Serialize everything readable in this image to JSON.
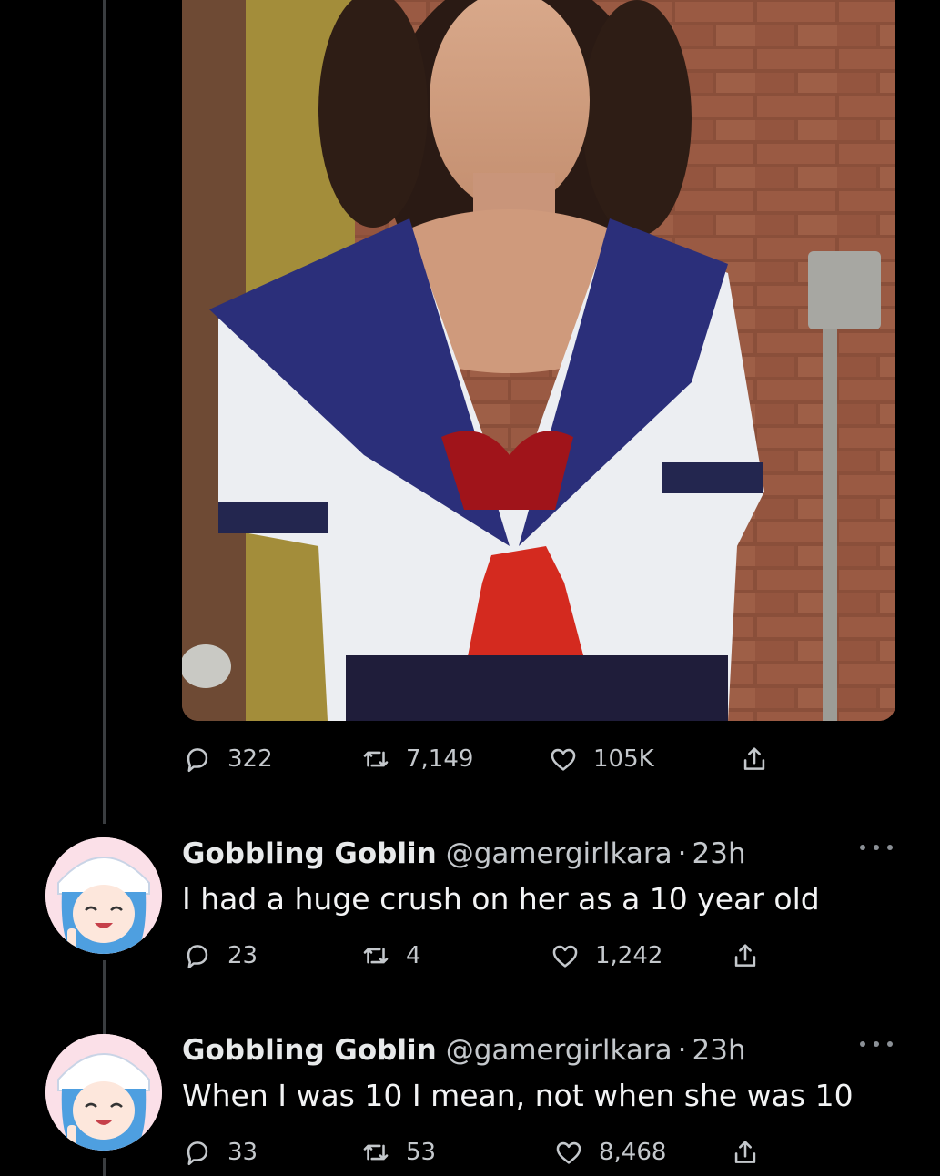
{
  "colors": {
    "background": "#000000",
    "text_primary": "#e7e9ea",
    "text_secondary": "#c4c8cc",
    "thread_line": "#3a3d40"
  },
  "main_tweet": {
    "media_description_icon": "photo",
    "actions": {
      "replies": "322",
      "retweets": "7,149",
      "likes": "105K"
    }
  },
  "replies": [
    {
      "avatar_icon": "anime-avatar-icon",
      "display_name": "Gobbling Goblin",
      "handle": "@gamergirlkara",
      "separator": "·",
      "time": "23h",
      "text": "I had a huge crush on her as a 10 year old",
      "actions": {
        "replies": "23",
        "retweets": "4",
        "likes": "1,242"
      }
    },
    {
      "avatar_icon": "anime-avatar-icon",
      "display_name": "Gobbling Goblin",
      "handle": "@gamergirlkara",
      "separator": "·",
      "time": "23h",
      "text": "When I was 10 I mean, not when she was 10",
      "actions": {
        "replies": "33",
        "retweets": "53",
        "likes": "8,468"
      }
    }
  ]
}
